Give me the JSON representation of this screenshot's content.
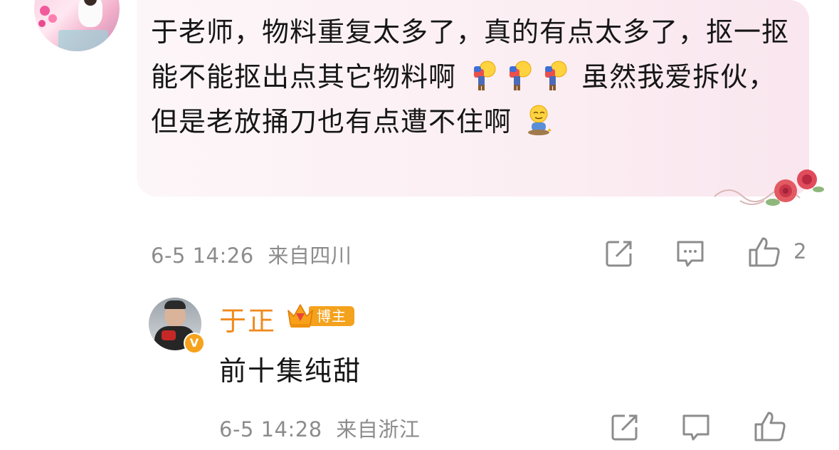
{
  "comment": {
    "text_before_first_emoji": "于老师，物料重复太多了，真的有点太多了，抠一抠能不能抠出点其它物料啊",
    "text_after_emojis": "虽然我爱拆伙，但是老放捅刀也有点遭不住啊",
    "emojis": [
      "bow-emoji",
      "bow-emoji",
      "bow-emoji",
      "awkward-sit-emoji"
    ],
    "timestamp": "6-5 14:26",
    "location": "来自四川",
    "like_count": "2"
  },
  "reply": {
    "author": "于正",
    "badge": "博主",
    "text": "前十集纯甜",
    "timestamp": "6-5 14:28",
    "location": "来自浙江",
    "verified_mark": "V"
  },
  "colors": {
    "bubble": "#fbeef3",
    "author_name": "#f08a1c",
    "badge": "#f4a21d",
    "meta_text": "#8c8c8c"
  },
  "icons": [
    "share-icon",
    "comment-icon",
    "like-icon"
  ]
}
